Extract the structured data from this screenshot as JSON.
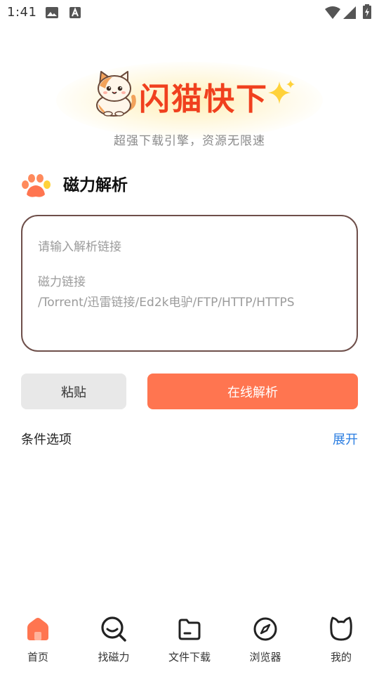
{
  "status_bar": {
    "time": "1:41",
    "icons": [
      "image-icon",
      "text-a-icon",
      "wifi-icon",
      "signal-icon",
      "battery-icon"
    ]
  },
  "header": {
    "app_title": "闪猫快下",
    "tagline": "超强下载引擎，资源无限速"
  },
  "magnet_section": {
    "title": "磁力解析",
    "input": {
      "placeholder_line1": "请输入解析链接",
      "placeholder_line2": "磁力链接",
      "placeholder_line3": "/Torrent/迅雷链接/Ed2k电驴/FTP/HTTP/HTTPS",
      "value": ""
    },
    "paste_button": "粘贴",
    "parse_button": "在线解析"
  },
  "options": {
    "label": "条件选项",
    "expand_link": "展开"
  },
  "bottom_nav": {
    "items": [
      {
        "label": "首页",
        "icon": "home-icon",
        "active": true
      },
      {
        "label": "找磁力",
        "icon": "search-magnet-icon",
        "active": false
      },
      {
        "label": "文件下载",
        "icon": "folder-icon",
        "active": false
      },
      {
        "label": "浏览器",
        "icon": "compass-icon",
        "active": false
      },
      {
        "label": "我的",
        "icon": "cat-face-icon",
        "active": false
      }
    ]
  },
  "colors": {
    "brand_title": "#f0401e",
    "accent_button": "#ff7550",
    "active_nav": "#ff7550",
    "link": "#2a7de1",
    "input_border": "#6e4f4a"
  }
}
